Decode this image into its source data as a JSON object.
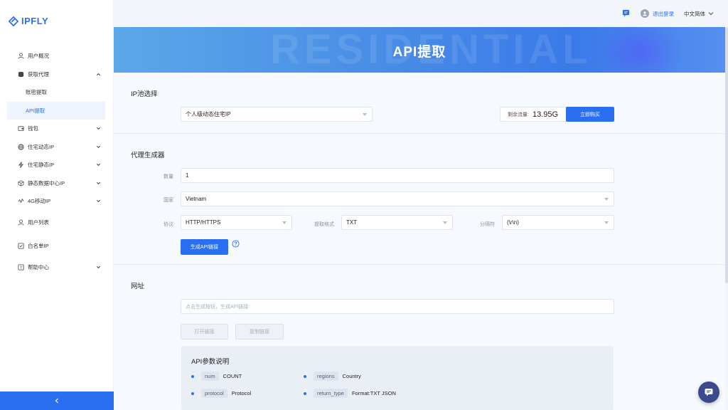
{
  "brand": {
    "name": "IPFLY",
    "color": "#2a6ff0"
  },
  "sidebar": {
    "items": [
      {
        "label": "用户概况",
        "icon": "user-icon",
        "expandable": false
      },
      {
        "label": "获取代理",
        "icon": "database-icon",
        "expandable": true,
        "expanded": true
      },
      {
        "label": "账密提取",
        "sub": true
      },
      {
        "label": "API提取",
        "sub": true,
        "active": true
      },
      {
        "label": "钱包",
        "icon": "wallet-icon",
        "expandable": true
      },
      {
        "label": "住宅动态IP",
        "icon": "globe-icon",
        "expandable": true
      },
      {
        "label": "住宅静态IP",
        "icon": "bolt-icon",
        "expandable": true
      },
      {
        "label": "静态数据中心IP",
        "icon": "cube-icon",
        "expandable": true
      },
      {
        "label": "4G移动IP",
        "icon": "signal-icon",
        "expandable": true
      },
      {
        "label": "用户列表",
        "icon": "user-list-icon",
        "expandable": false
      },
      {
        "label": "白名单IP",
        "icon": "whitelist-icon",
        "expandable": false
      },
      {
        "label": "帮助中心",
        "icon": "help-icon",
        "expandable": true
      }
    ],
    "collapse_icon": "chevron-left-icon"
  },
  "topbar": {
    "logout": "退出登录",
    "language": "中文简体"
  },
  "banner": {
    "title": "API提取",
    "bg_text": "RESIDENTIAL"
  },
  "ip_pool": {
    "title": "IP池选择",
    "selected": "个人级动态住宅IP",
    "traffic_label": "剩余流量:",
    "traffic_value": "13.95G",
    "buy_button": "立即购买"
  },
  "generator": {
    "title": "代理生成器",
    "quantity_label": "数量",
    "quantity_value": "1",
    "country_label": "国家",
    "country_value": "Vietnam",
    "protocol_label": "协议",
    "protocol_value": "HTTP/HTTPS",
    "format_label": "提取格式",
    "format_value": "TXT",
    "separator_label": "分隔符",
    "separator_value": "(\\r\\n)",
    "generate_button": "生成API链接"
  },
  "url_section": {
    "title": "网址",
    "placeholder": "点击生成按钮，生成API链接",
    "open_button": "打开链接",
    "copy_button": "复制链接"
  },
  "params": {
    "title": "API参数说明",
    "items": [
      {
        "key": "num",
        "desc": "COUNT"
      },
      {
        "key": "regions",
        "desc": "Country"
      },
      {
        "key": "protocol",
        "desc": "Protocol"
      },
      {
        "key": "return_type",
        "desc": "Format:TXT JSON"
      }
    ]
  }
}
